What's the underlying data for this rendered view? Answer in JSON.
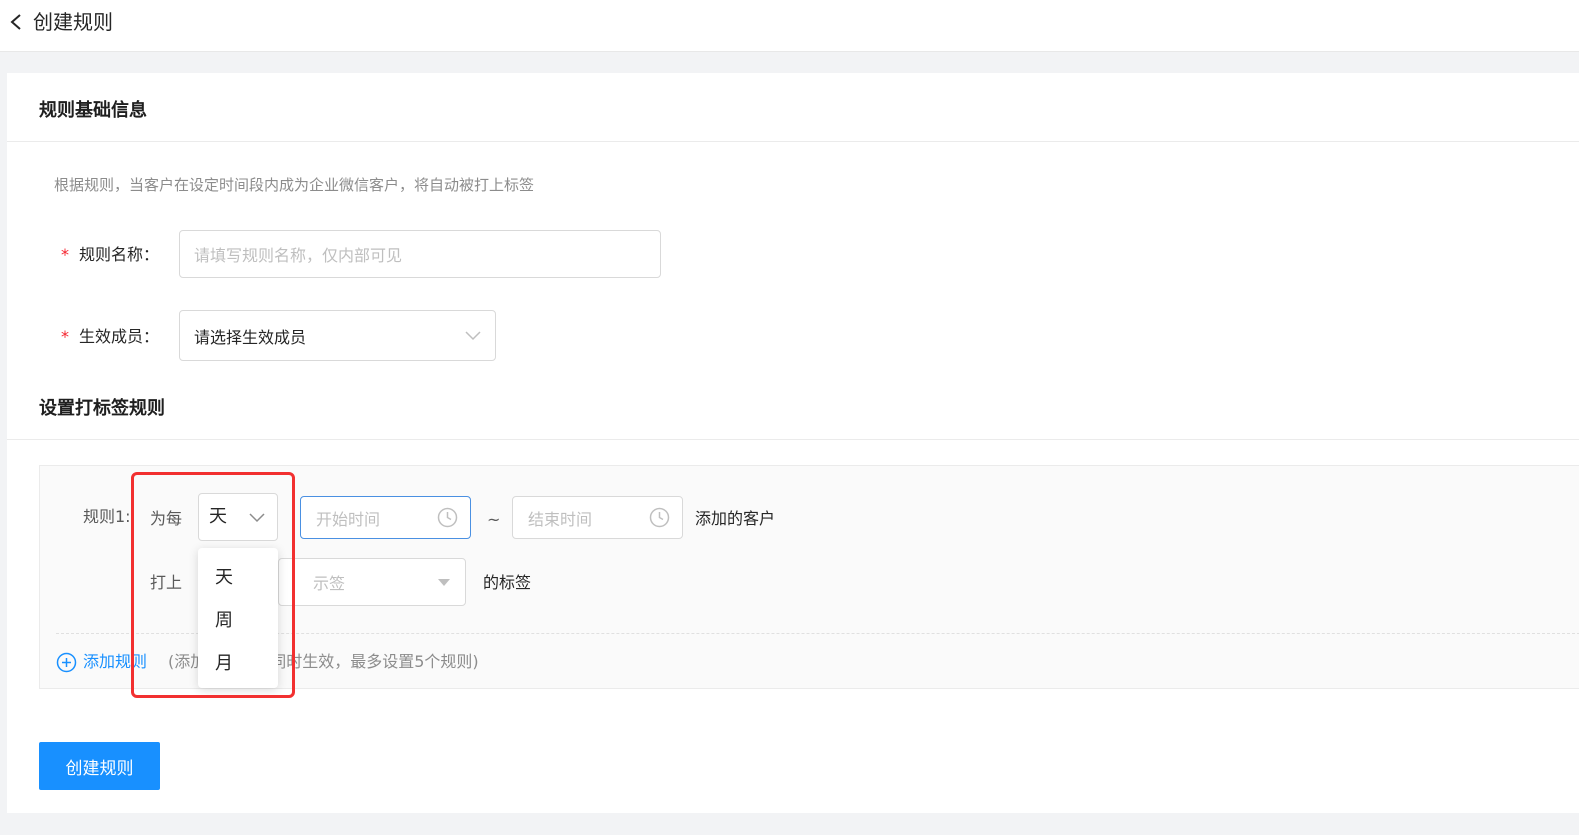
{
  "header": {
    "title": "创建规则"
  },
  "basic_info": {
    "section_title": "规则基础信息",
    "hint": "根据规则，当客户在设定时间段内成为企业微信客户，将自动被打上标签",
    "required_mark": "*",
    "name_label": "规则名称：",
    "name_placeholder": "请填写规则名称，仅内部可见",
    "member_label": "生效成员：",
    "member_select_text": "请选择生效成员"
  },
  "tag_rules": {
    "section_title": "设置打标签规则",
    "rule_label": "规则1:",
    "per_label": "为每",
    "unit_value": "天",
    "start_placeholder": "开始时间",
    "separator": "~",
    "end_placeholder": "结束时间",
    "customers_suffix": "添加的客户",
    "tag_prefix": "打上",
    "tag_select_partial": "示签",
    "tag_suffix": "的标签",
    "add_rule_label": "添加规则",
    "add_rule_hint": "(添加的规则可同时生效，最多设置5个规则)",
    "unit_options": [
      "天",
      "周",
      "月"
    ]
  },
  "actions": {
    "create_button": "创建规则"
  },
  "colors": {
    "primary": "#1890ff",
    "required": "#f5222d",
    "highlight": "#f23030",
    "active_border": "#4a90e2"
  }
}
